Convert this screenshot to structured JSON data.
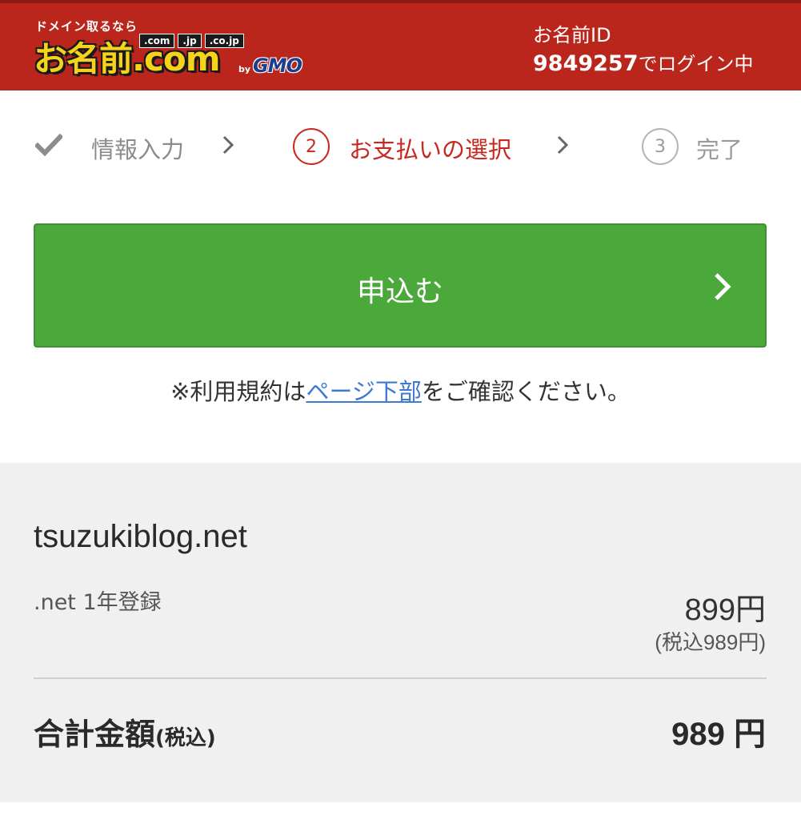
{
  "header": {
    "logo": {
      "tagline": "ドメイン取るなら",
      "tlds": [
        ".com",
        ".jp",
        ".co.jp"
      ],
      "name": "お名前.com",
      "by": "by",
      "brand": "GMO"
    },
    "user_id_label": "お名前ID",
    "user_id": "9849257",
    "login_suffix": "でログイン中"
  },
  "steps": [
    {
      "label": "情報入力",
      "state": "done",
      "icon": "check-icon"
    },
    {
      "number": "2",
      "label": "お支払いの選択",
      "state": "current"
    },
    {
      "number": "3",
      "label": "完了",
      "state": "upcoming"
    }
  ],
  "apply_button": {
    "label": "申込む"
  },
  "terms_note": {
    "prefix": "※利用規約は",
    "link": "ページ下部",
    "suffix": "をご確認ください。"
  },
  "summary": {
    "domain": "tsuzukiblog.net",
    "plan": ".net 1年登録",
    "price": "899円",
    "price_tax": "(税込989円)",
    "total_label": "合計金額",
    "total_tax_note": "(税込)",
    "total_value": "989 円"
  },
  "colors": {
    "header_bg": "#bb261c",
    "accent_red": "#c8281e",
    "button_green": "#4ba83a",
    "link_blue": "#3c7ad6",
    "panel_bg": "#f0f0f0"
  }
}
